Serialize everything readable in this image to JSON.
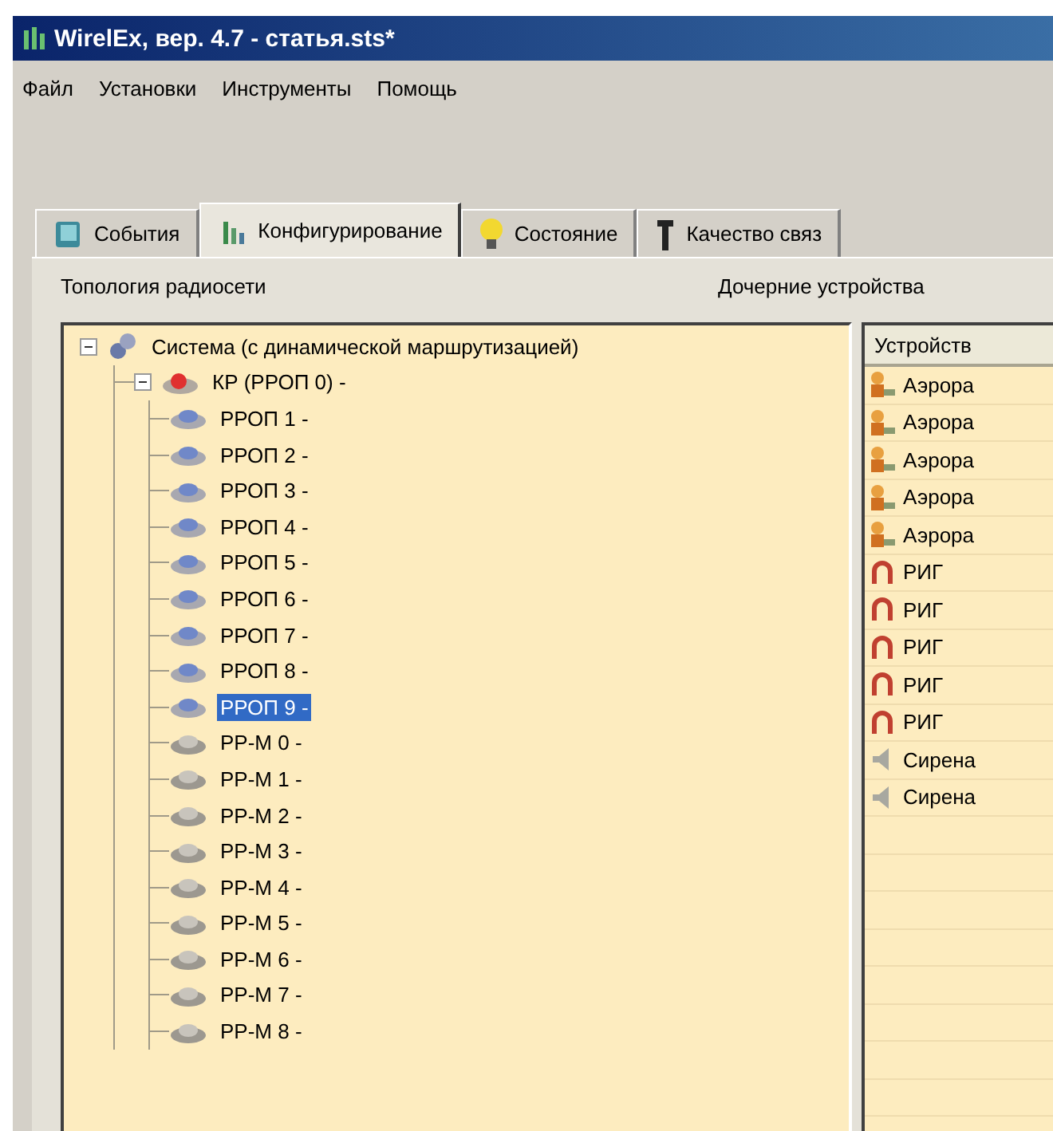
{
  "window": {
    "title": "WirelEx, вер. 4.7 - статья.sts*"
  },
  "menu": [
    "Файл",
    "Установки",
    "Инструменты",
    "Помощь"
  ],
  "tabs": [
    {
      "label": "События",
      "kind": "events",
      "selected": false
    },
    {
      "label": "Конфигурирование",
      "kind": "config",
      "selected": true
    },
    {
      "label": "Состояние",
      "kind": "bulb",
      "selected": false
    },
    {
      "label": "Качество связ",
      "kind": "signal",
      "selected": false
    }
  ],
  "topology": {
    "label": "Топология радиосети",
    "tree": [
      {
        "label": "Система (с динамической маршрутизацией)",
        "kind": "system",
        "expanded": true,
        "selected": false,
        "children": [
          {
            "label": "КР (РРОП 0) -",
            "kind": "kr",
            "expanded": true,
            "selected": false,
            "children": [
              {
                "label": "РРОП 1 -",
                "kind": "rrop",
                "selected": false
              },
              {
                "label": "РРОП 2 -",
                "kind": "rrop",
                "selected": false
              },
              {
                "label": "РРОП 3 -",
                "kind": "rrop",
                "selected": false
              },
              {
                "label": "РРОП 4 -",
                "kind": "rrop",
                "selected": false
              },
              {
                "label": "РРОП 5 -",
                "kind": "rrop",
                "selected": false
              },
              {
                "label": "РРОП 6 -",
                "kind": "rrop",
                "selected": false
              },
              {
                "label": "РРОП 7 -",
                "kind": "rrop",
                "selected": false
              },
              {
                "label": "РРОП 8 -",
                "kind": "rrop",
                "selected": false
              },
              {
                "label": "РРОП 9 -",
                "kind": "rrop",
                "selected": true
              },
              {
                "label": "РР-М 0 -",
                "kind": "rrm",
                "selected": false
              },
              {
                "label": "РР-М 1 -",
                "kind": "rrm",
                "selected": false
              },
              {
                "label": "РР-М 2 -",
                "kind": "rrm",
                "selected": false
              },
              {
                "label": "РР-М 3 -",
                "kind": "rrm",
                "selected": false
              },
              {
                "label": "РР-М 4 -",
                "kind": "rrm",
                "selected": false
              },
              {
                "label": "РР-М 5 -",
                "kind": "rrm",
                "selected": false
              },
              {
                "label": "РР-М 6 -",
                "kind": "rrm",
                "selected": false
              },
              {
                "label": "РР-М 7 -",
                "kind": "rrm",
                "selected": false
              },
              {
                "label": "РР-М 8 -",
                "kind": "rrm",
                "selected": false
              }
            ]
          }
        ]
      }
    ]
  },
  "child_devices": {
    "label": "Дочерние устройства",
    "columns": [
      "Устройств"
    ],
    "rows": [
      {
        "name": "Аэрора",
        "kind": "aerora"
      },
      {
        "name": "Аэрора",
        "kind": "aerora"
      },
      {
        "name": "Аэрора",
        "kind": "aerora"
      },
      {
        "name": "Аэрора",
        "kind": "aerora"
      },
      {
        "name": "Аэрора",
        "kind": "aerora"
      },
      {
        "name": "РИГ",
        "kind": "rig"
      },
      {
        "name": "РИГ",
        "kind": "rig"
      },
      {
        "name": "РИГ",
        "kind": "rig"
      },
      {
        "name": "РИГ",
        "kind": "rig"
      },
      {
        "name": "РИГ",
        "kind": "rig"
      },
      {
        "name": "Сирена",
        "kind": "siren"
      },
      {
        "name": "Сирена",
        "kind": "siren"
      }
    ]
  }
}
